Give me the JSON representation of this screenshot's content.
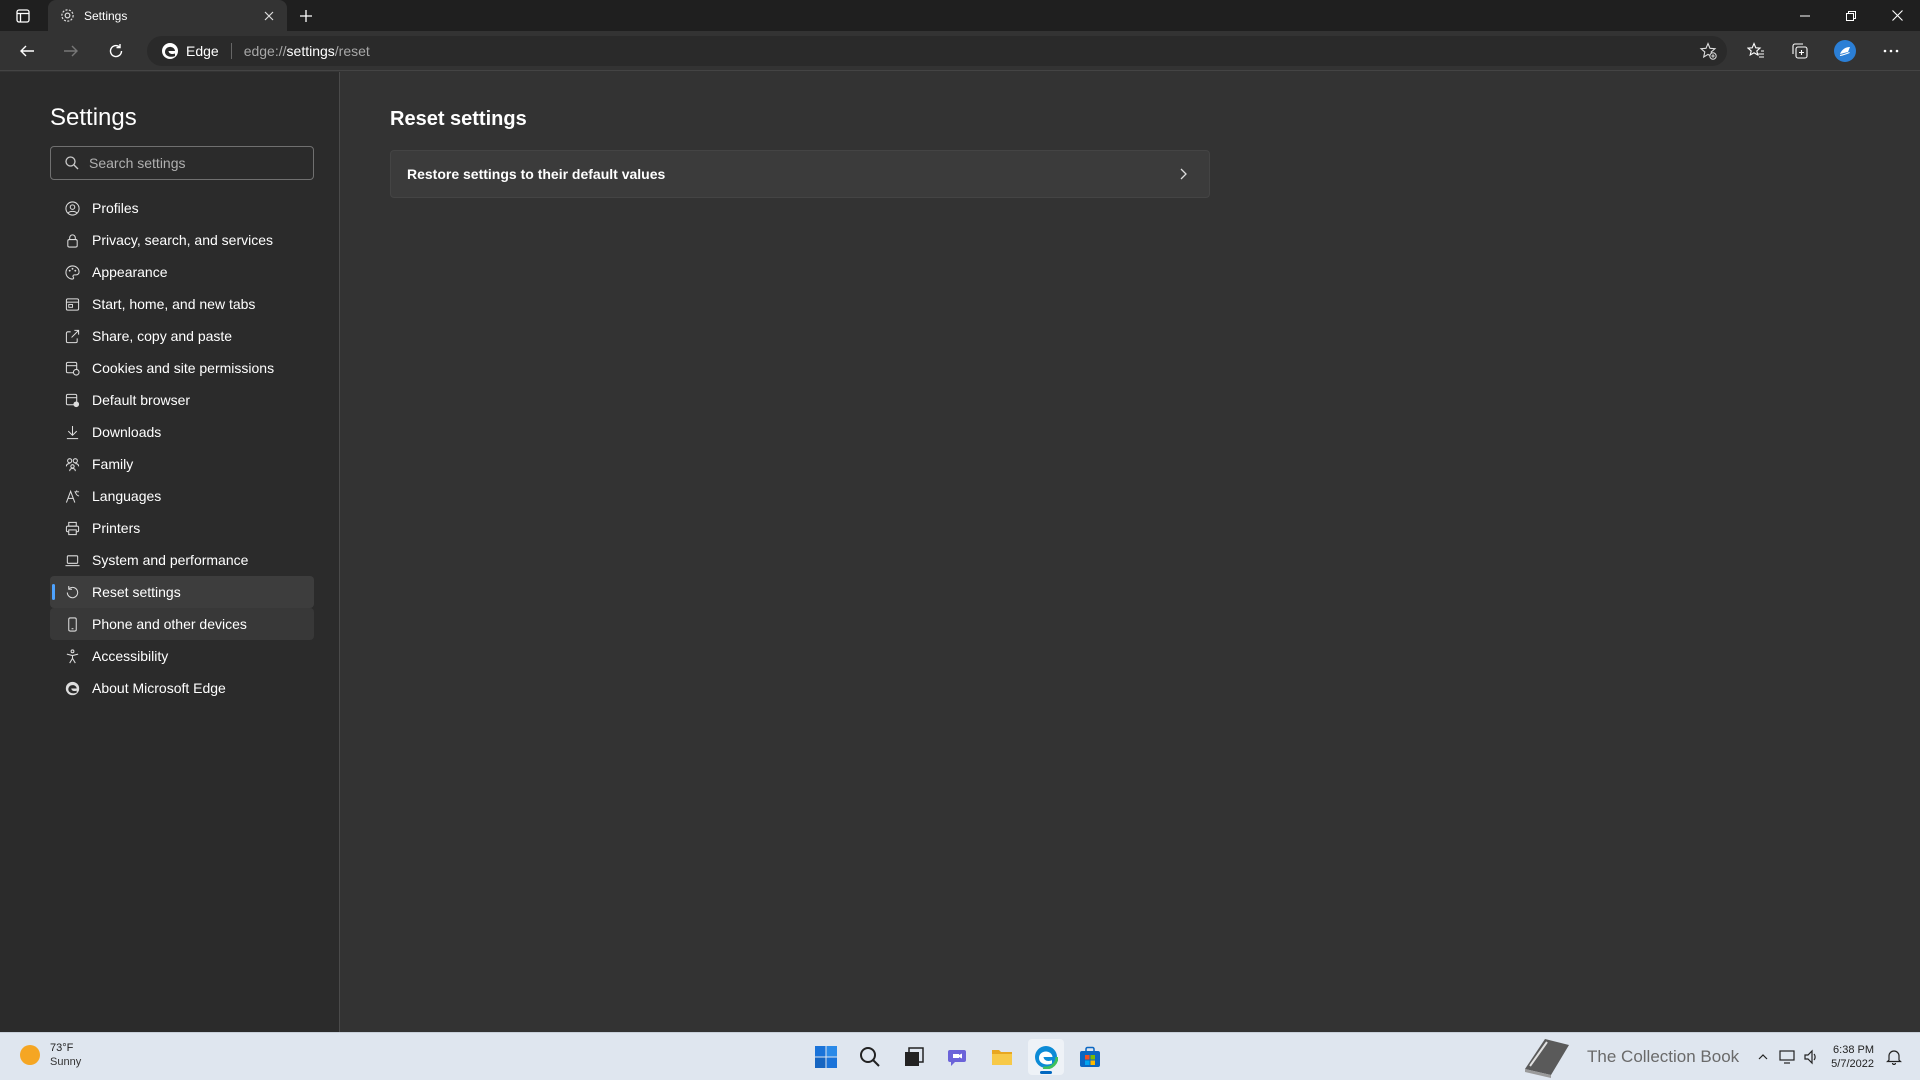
{
  "browser": {
    "tab_title": "Settings",
    "site_label": "Edge",
    "url_scheme": "edge://",
    "url_host": "settings",
    "url_path": "/reset"
  },
  "sidebar": {
    "title": "Settings",
    "search_placeholder": "Search settings",
    "items": [
      {
        "label": "Profiles",
        "icon": "profile-icon"
      },
      {
        "label": "Privacy, search, and services",
        "icon": "lock-icon"
      },
      {
        "label": "Appearance",
        "icon": "palette-icon"
      },
      {
        "label": "Start, home, and new tabs",
        "icon": "home-tabs-icon"
      },
      {
        "label": "Share, copy and paste",
        "icon": "share-icon"
      },
      {
        "label": "Cookies and site permissions",
        "icon": "cookies-icon"
      },
      {
        "label": "Default browser",
        "icon": "browser-icon"
      },
      {
        "label": "Downloads",
        "icon": "download-icon"
      },
      {
        "label": "Family",
        "icon": "family-icon"
      },
      {
        "label": "Languages",
        "icon": "language-icon"
      },
      {
        "label": "Printers",
        "icon": "printer-icon"
      },
      {
        "label": "System and performance",
        "icon": "laptop-icon"
      },
      {
        "label": "Reset settings",
        "icon": "reset-icon"
      },
      {
        "label": "Phone and other devices",
        "icon": "phone-icon"
      },
      {
        "label": "Accessibility",
        "icon": "accessibility-icon"
      },
      {
        "label": "About Microsoft Edge",
        "icon": "edge-icon"
      }
    ]
  },
  "main": {
    "title": "Reset settings",
    "card_label": "Restore settings to their default values"
  },
  "taskbar": {
    "temperature": "73°F",
    "condition": "Sunny",
    "time": "6:38 PM",
    "date": "5/7/2022",
    "watermark": "The Collection Book"
  },
  "colors": {
    "accent": "#4ea3ff",
    "background": "#333333",
    "sidebar": "#2b2b2b"
  }
}
